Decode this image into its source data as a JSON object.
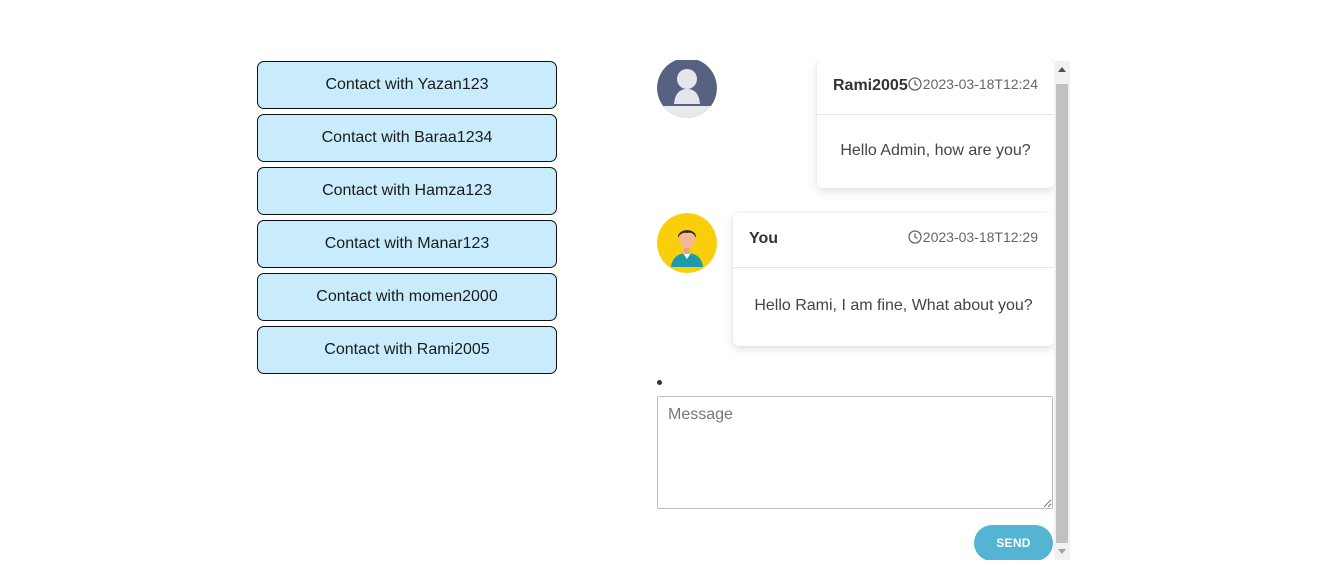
{
  "contacts": [
    {
      "label": "Contact with Yazan123"
    },
    {
      "label": "Contact with Baraa1234"
    },
    {
      "label": "Contact with Hamza123"
    },
    {
      "label": "Contact with Manar123"
    },
    {
      "label": "Contact with momen2000"
    },
    {
      "label": "Contact with Rami2005"
    }
  ],
  "messages": [
    {
      "sender": "Rami2005",
      "timestamp": "2023-03-18T12:24",
      "text": "Hello Admin, how are you?",
      "avatar": "default-user-avatar"
    },
    {
      "sender": "You",
      "timestamp": "2023-03-18T12:29",
      "text": "Hello Rami, I am fine, What about you?",
      "avatar": "boy-avatar"
    }
  ],
  "composer": {
    "placeholder": "Message",
    "value": "",
    "send_label": "SEND"
  },
  "icons": {
    "timestamp": "clock-icon",
    "scroll_up": "scroll-up-arrow-icon",
    "scroll_down": "scroll-down-arrow-icon"
  },
  "colors": {
    "contact_bg": "#c8ecfc",
    "send_bg": "#54b4d3",
    "avatar_yellow": "#f9cf0c",
    "avatar_slate": "#566280"
  }
}
